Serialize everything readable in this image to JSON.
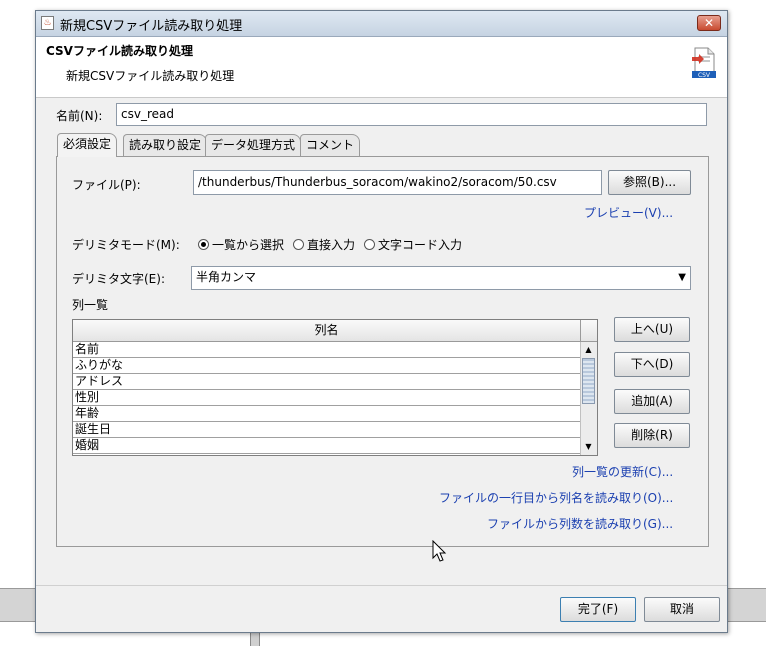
{
  "window": {
    "title": "新規CSVファイル読み取り処理",
    "close_glyph": "✕"
  },
  "header": {
    "title": "CSVファイル読み取り処理",
    "subtitle": "新規CSVファイル読み取り処理",
    "icon": "csv-file-icon",
    "icon_text": "CSV"
  },
  "name_field": {
    "label": "名前(N):",
    "value": "csv_read"
  },
  "tabs": [
    {
      "label": "必須設定",
      "active": true
    },
    {
      "label": "読み取り設定",
      "active": false
    },
    {
      "label": "データ処理方式",
      "active": false
    },
    {
      "label": "コメント",
      "active": false
    }
  ],
  "file": {
    "label": "ファイル(P):",
    "value": "/thunderbus/Thunderbus_soracom/wakino2/soracom/50.csv",
    "browse_label": "参照(B)..."
  },
  "preview_link": "プレビュー(V)...",
  "delimiter_mode": {
    "label": "デリミタモード(M):",
    "options": [
      {
        "label": "一覧から選択",
        "selected": true
      },
      {
        "label": "直接入力",
        "selected": false
      },
      {
        "label": "文字コード入力",
        "selected": false
      }
    ]
  },
  "delimiter_char": {
    "label": "デリミタ文字(E):",
    "value": "半角カンマ"
  },
  "columns": {
    "section_label": "列一覧",
    "header": "列名",
    "rows": [
      "名前",
      "ふりがな",
      "アドレス",
      "性別",
      "年齢",
      "誕生日",
      "婚姻"
    ],
    "buttons": {
      "up": "上へ(U)",
      "down": "下へ(D)",
      "add": "追加(A)",
      "delete": "削除(R)"
    }
  },
  "links": {
    "refresh": "列一覧の更新(C)...",
    "read_names": "ファイルの一行目から列名を読み取り(O)...",
    "read_count": "ファイルから列数を読み取り(G)..."
  },
  "footer": {
    "finish_label": "完了(F)",
    "cancel_label": "取消"
  },
  "colors": {
    "link": "#1a3fb0",
    "dialog_bg": "#f0f0f0",
    "titlebar": "#c6d3e2"
  }
}
